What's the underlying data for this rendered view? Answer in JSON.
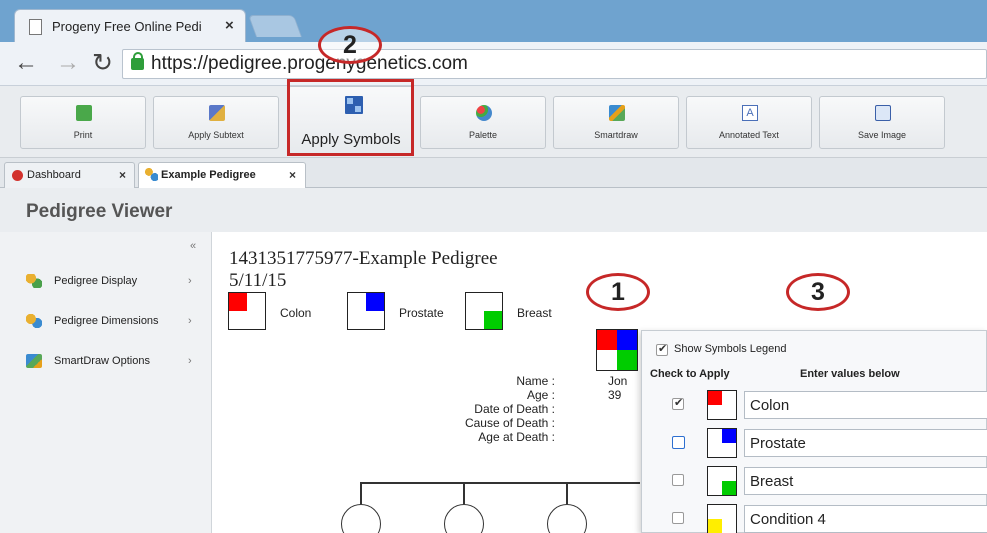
{
  "browser": {
    "tab_title": "Progeny Free Online Pedi",
    "tab_close": "×",
    "url": "https://pedigree.progenygenetics.com"
  },
  "toolbar": {
    "buttons": [
      {
        "label": "Print",
        "icon": "print-icon"
      },
      {
        "label": "Apply Subtext",
        "icon": "subtext-icon"
      },
      {
        "label": "Apply Symbols",
        "icon": "symbols-icon"
      },
      {
        "label": "Palette",
        "icon": "palette-icon"
      },
      {
        "label": "Smartdraw",
        "icon": "smartdraw-icon"
      },
      {
        "label": "Annotated Text",
        "icon": "annotated-text-icon"
      },
      {
        "label": "Save Image",
        "icon": "save-image-icon"
      }
    ]
  },
  "doc_tabs": [
    {
      "label": "Dashboard",
      "close": "×"
    },
    {
      "label": "Example Pedigree",
      "close": "×"
    }
  ],
  "viewer": {
    "title": "Pedigree Viewer"
  },
  "sidebar": {
    "collapse": "«",
    "items": [
      {
        "label": "Pedigree Display",
        "chevron": "›"
      },
      {
        "label": "Pedigree Dimensions",
        "chevron": "›"
      },
      {
        "label": "SmartDraw Options",
        "chevron": "›"
      }
    ]
  },
  "pedigree": {
    "title": "1431351775977-Example Pedigree",
    "date": "5/11/15",
    "legend": [
      {
        "label": "Colon",
        "color": "#ff0000",
        "quadrant": "top-left"
      },
      {
        "label": "Prostate",
        "color": "#0000ff",
        "quadrant": "top-right"
      },
      {
        "label": "Breast",
        "color": "#00cc00",
        "quadrant": "bottom-right"
      }
    ],
    "individual": {
      "labels": [
        "Name :",
        "Age :",
        "Date of Death :",
        "Cause of Death :",
        "Age at Death :"
      ],
      "name": "Jon",
      "age": "39",
      "symbol_colors": {
        "top_left": "#ff0000",
        "top_right": "#0000ff",
        "bottom_right": "#00cc00"
      }
    }
  },
  "symbols_panel": {
    "show_legend": "Show Symbols Legend",
    "show_legend_checked": true,
    "col_check": "Check to Apply",
    "col_values": "Enter values below",
    "rows": [
      {
        "value": "Colon",
        "checked": true,
        "color": "#ff0000",
        "quadrant": "top-left"
      },
      {
        "value": "Prostate",
        "checked": false,
        "color": "#0000ff",
        "quadrant": "top-right"
      },
      {
        "value": "Breast",
        "checked": false,
        "color": "#00cc00",
        "quadrant": "bottom-right"
      },
      {
        "value": "Condition 4",
        "checked": false,
        "color": "#ffee00",
        "quadrant": "bottom-left"
      }
    ]
  },
  "callouts": {
    "one": "1",
    "two": "2",
    "three": "3"
  },
  "colors": {
    "callout_red": "#c62828",
    "titlebar": "#6fa3cf"
  }
}
